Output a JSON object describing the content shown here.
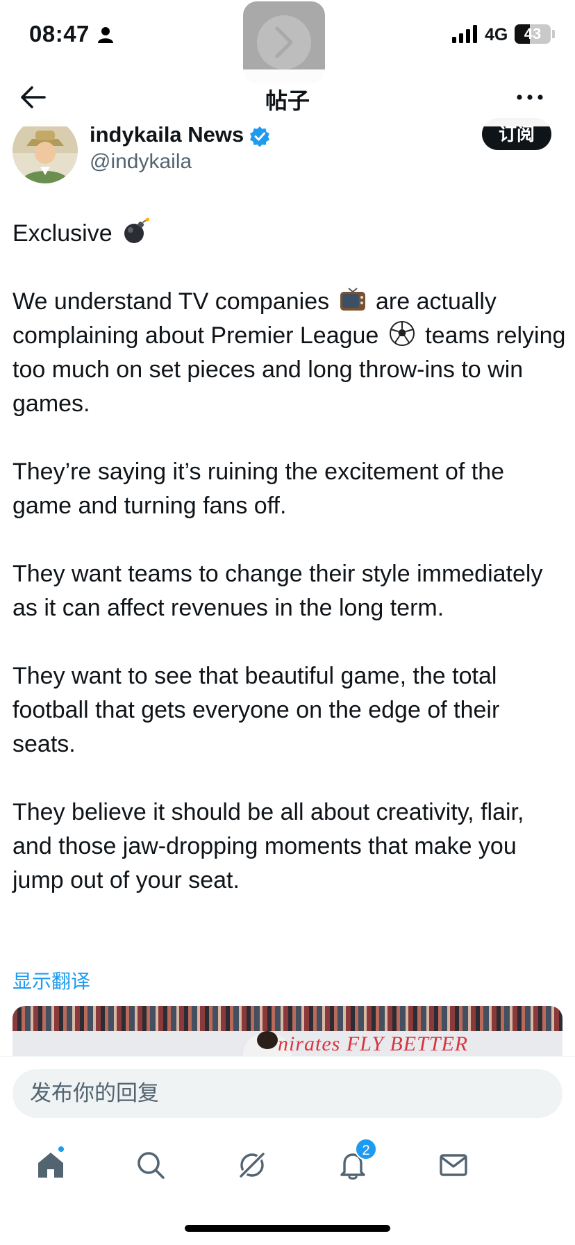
{
  "status_bar": {
    "time": "08:47",
    "network": "4G",
    "battery_level": "43",
    "icons": [
      "person-icon",
      "signal-icon",
      "battery-icon"
    ]
  },
  "nav": {
    "title": "帖子",
    "back_icon": "arrow-left-icon",
    "more_icon": "more-horizontal-icon"
  },
  "author": {
    "display_name": "indykaila News",
    "handle": "@indykaila",
    "verified": true,
    "subscribe_label": "订阅"
  },
  "tweet": {
    "paragraphs": [
      "Exclusive 💣",
      "We understand TV companies 📺 are actually complaining about Premier League ⚽ teams relying too much on set pieces and long throw-ins to win games.",
      "They’re saying it’s ruining the excitement of the game and turning fans off.",
      "They want teams to change their style immediately as it can affect revenues in the long term.",
      "They want to see that beautiful game, the total football that gets everyone on the edge of their seats.",
      "They believe it should be all about creativity, flair, and those jaw-dropping moments that make you jump out of your seat."
    ],
    "translate_label": "显示翻译",
    "media_visible_text": "nirates FLY BETTER"
  },
  "reply": {
    "placeholder": "发布你的回复"
  },
  "tab_bar": {
    "tabs": [
      "home-icon",
      "search-icon",
      "grok-icon",
      "notifications-icon",
      "messages-icon"
    ],
    "notification_count": "2"
  },
  "colors": {
    "accent": "#1d9bf0",
    "text": "#0f1419",
    "secondary_text": "#536471"
  }
}
